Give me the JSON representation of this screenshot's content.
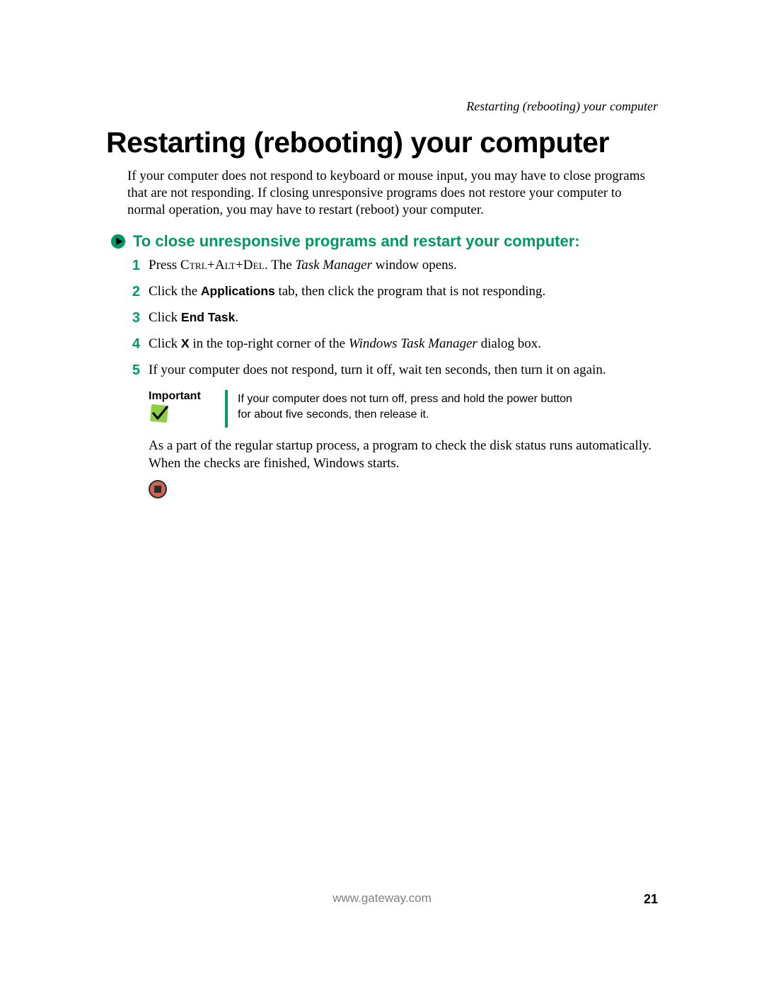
{
  "running_header": "Restarting (rebooting) your computer",
  "title": "Restarting (rebooting) your computer",
  "intro": "If your computer does not respond to keyboard or mouse input, you may have to close programs that are not responding. If closing unresponsive programs does not restore your computer to normal operation, you may have to restart (reboot) your computer.",
  "section_heading": "To close unresponsive programs and restart your computer:",
  "steps": {
    "n1": "1",
    "s1_a": "Press ",
    "s1_key": "Ctrl+Alt+Del",
    "s1_b": ". The ",
    "s1_win": "Task Manager",
    "s1_c": " window opens.",
    "n2": "2",
    "s2_a": "Click the ",
    "s2_tab": "Applications",
    "s2_b": " tab, then click the program that is not responding.",
    "n3": "3",
    "s3_a": "Click ",
    "s3_btn": "End Task",
    "s3_b": ".",
    "n4": "4",
    "s4_a": "Click ",
    "s4_x": "X",
    "s4_b": " in the top-right corner of the ",
    "s4_win": "Windows Task Manager",
    "s4_c": " dialog box.",
    "n5": "5",
    "s5": "If your computer does not respond, turn it off, wait ten seconds, then turn it on again."
  },
  "note": {
    "label": "Important",
    "text": "If your computer does not turn off, press and hold the power button for about five seconds, then release it."
  },
  "closing": "As a part of the regular startup process, a program to check the disk status runs automatically. When the checks are finished, Windows starts.",
  "footer_url": "www.gateway.com",
  "page_number": "21",
  "colors": {
    "accent": "#009966",
    "stop_fill": "#cc6655",
    "stop_inner": "#2a2a2a"
  }
}
